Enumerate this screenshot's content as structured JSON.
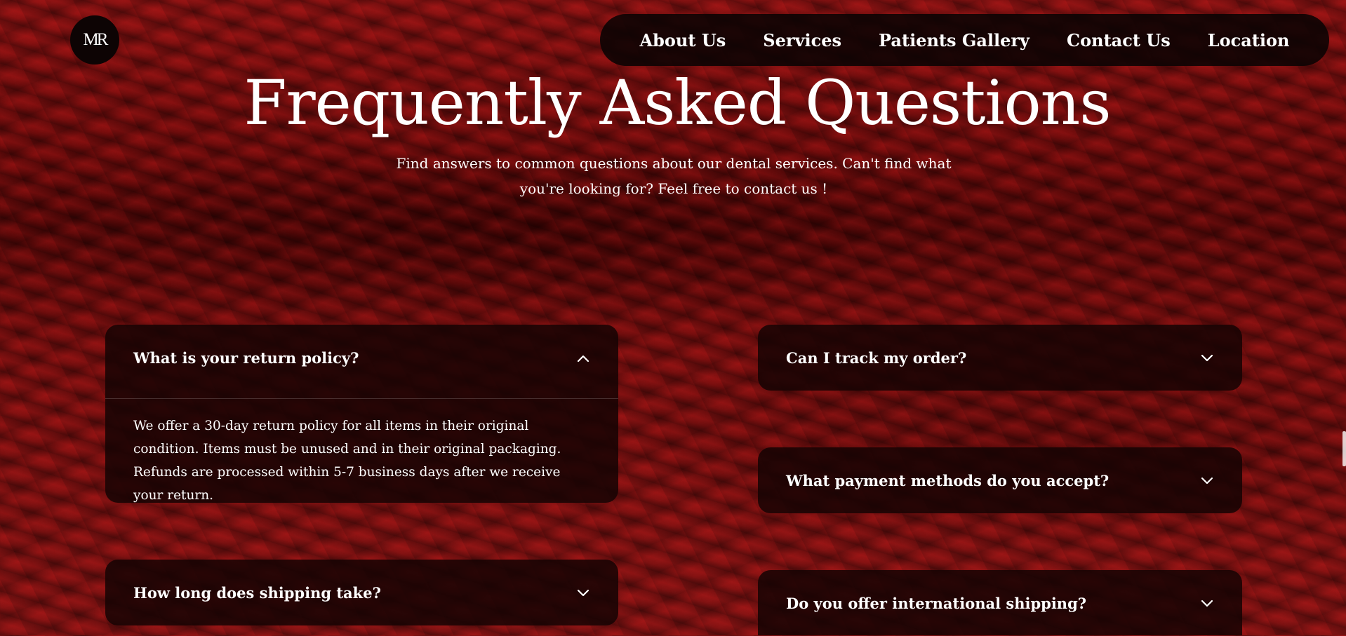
{
  "logo": {
    "text": "MR"
  },
  "nav": {
    "items": [
      "About Us",
      "Services",
      "Patients Gallery",
      "Contact Us",
      "Location"
    ]
  },
  "hero": {
    "title": "Frequently Asked Questions",
    "subtitle": "Find answers to common questions about our dental services. Can't find what you're looking for? Feel free to contact us !"
  },
  "faq": [
    {
      "question": "What is your return policy?",
      "expanded": true,
      "answer": "We offer a 30-day return policy for all items in their original condition. Items must be unused and in their original packaging. Refunds are processed within 5-7 business days after we receive your return.",
      "icon": "chevron-up-icon"
    },
    {
      "question": "Can I track my order?",
      "expanded": false,
      "icon": "chevron-down-icon"
    },
    {
      "question": "What payment methods do you accept?",
      "expanded": false,
      "icon": "chevron-down-icon"
    },
    {
      "question": "How long does shipping take?",
      "expanded": false,
      "icon": "chevron-down-icon"
    },
    {
      "question": "Do you offer international shipping?",
      "expanded": false,
      "icon": "chevron-down-icon"
    }
  ],
  "colors": {
    "background": "#7a0f0f",
    "panel": "#160404",
    "text": "#ffffff"
  }
}
